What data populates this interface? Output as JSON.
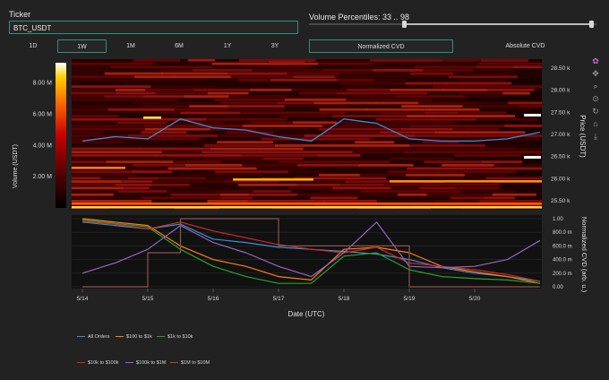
{
  "ticker": {
    "label": "Ticker",
    "value": "BTC_USDT"
  },
  "timeframes": [
    {
      "label": "1D",
      "active": false
    },
    {
      "label": "1W",
      "active": true
    },
    {
      "label": "1M",
      "active": false
    },
    {
      "label": "6M",
      "active": false
    },
    {
      "label": "1Y",
      "active": false
    },
    {
      "label": "3Y",
      "active": false
    }
  ],
  "volume_percentiles": {
    "label": "Volume Percentiles: 33 .. 98",
    "low": 33,
    "high": 98
  },
  "cvd_modes": [
    {
      "label": "Normalized CVD",
      "active": true
    },
    {
      "label": "Absolute CVD",
      "active": false
    }
  ],
  "modebar_icons": [
    "plotly-logo-icon",
    "pan-icon",
    "zoom-icon",
    "lasso-icon",
    "autoscale-icon",
    "reset-icon",
    "save-icon"
  ],
  "chart_data": [
    {
      "type": "heatmap",
      "title": "",
      "ylabel": "Price (USDT)",
      "ylim": [
        25300,
        28700
      ],
      "y_ticks": [
        "25.50 k",
        "26.00 k",
        "26.50 k",
        "27.00 k",
        "27.50 k",
        "28.00 k",
        "28.50 k"
      ],
      "y_tick_values": [
        25500,
        26000,
        26500,
        27000,
        27500,
        28000,
        28500
      ],
      "colorbar": {
        "label": "Volume (USDT)",
        "ticks": [
          "2.00 M",
          "4.00 M",
          "6.00 M",
          "8.00 M"
        ],
        "tick_values": [
          2000000,
          4000000,
          6000000,
          8000000
        ],
        "range": [
          0,
          9300000
        ]
      },
      "colorscale": [
        "#000000",
        "#5a0000",
        "#c40000",
        "#ff6600",
        "#ffd000",
        "#ffffff"
      ],
      "price_series": {
        "name": "",
        "color": "#3b8fd9",
        "x": [
          "2023-05-14",
          "2023-05-14 12:00",
          "2023-05-15",
          "2023-05-15 12:00",
          "2023-05-16",
          "2023-05-16 12:00",
          "2023-05-17",
          "2023-05-17 12:00",
          "2023-05-18",
          "2023-05-18 12:00",
          "2023-05-19",
          "2023-05-19 12:00",
          "2023-05-20",
          "2023-05-20 12:00",
          "2023-05-21"
        ],
        "y": [
          26850,
          26950,
          26900,
          27350,
          27150,
          27100,
          26950,
          26850,
          27350,
          27250,
          26900,
          26850,
          26850,
          26900,
          27050
        ]
      }
    },
    {
      "type": "line",
      "title": "",
      "xlabel": "Date (UTC)",
      "ylabel": "Normalized CVD (arb. u.)",
      "x_ticks": [
        "5/14",
        "5/15",
        "5/16",
        "5/17",
        "5/18",
        "5/19",
        "5/20"
      ],
      "y_left_ticks": [
        "0.00",
        "0.20",
        "0.40",
        "0.60",
        "0.80",
        "1.00"
      ],
      "y_left_values": [
        0,
        0.2,
        0.4,
        0.6,
        0.8,
        1.0
      ],
      "y_right_ticks": [
        "0.00",
        "200.0 m",
        "400.0 m",
        "600.0 m",
        "800.0 m",
        "1.00"
      ],
      "ylim": [
        0,
        1.0
      ],
      "x": [
        "5/14",
        "5/14 12h",
        "5/15",
        "5/15 12h",
        "5/16",
        "5/16 12h",
        "5/17",
        "5/17 12h",
        "5/18",
        "5/18 12h",
        "5/19",
        "5/19 12h",
        "5/20",
        "5/20 12h",
        "5/21"
      ],
      "series": [
        {
          "name": "All Orders",
          "color": "#3a8fd8",
          "values": [
            0.95,
            0.9,
            0.85,
            0.92,
            0.7,
            0.65,
            0.58,
            0.55,
            0.52,
            0.48,
            0.4,
            0.28,
            0.2,
            0.15,
            0.08
          ]
        },
        {
          "name": "$100 to $1k",
          "color": "#ff7f0e",
          "values": [
            1.0,
            0.95,
            0.9,
            0.6,
            0.4,
            0.3,
            0.15,
            0.1,
            0.55,
            0.58,
            0.5,
            0.3,
            0.22,
            0.15,
            0.05
          ]
        },
        {
          "name": "$1k to $10k",
          "color": "#2ca02c",
          "values": [
            0.98,
            0.93,
            0.88,
            0.55,
            0.3,
            0.15,
            0.05,
            0.05,
            0.45,
            0.5,
            0.25,
            0.15,
            0.12,
            0.1,
            0.05
          ]
        },
        {
          "name": "$10k to $100k",
          "color": "#d62728",
          "values": [
            0.96,
            0.92,
            0.85,
            0.95,
            0.82,
            0.72,
            0.62,
            0.55,
            0.5,
            0.58,
            0.35,
            0.3,
            0.25,
            0.18,
            0.08
          ]
        },
        {
          "name": "$100k to $1M",
          "color": "#9467bd",
          "values": [
            0.2,
            0.35,
            0.55,
            0.9,
            0.65,
            0.5,
            0.3,
            0.15,
            0.5,
            0.95,
            0.3,
            0.28,
            0.3,
            0.4,
            0.68
          ]
        },
        {
          "name": "$1M to $10M",
          "color": "#8c564b",
          "values": [
            0.0,
            0.0,
            0.5,
            1.0,
            1.0,
            1.0,
            0.6,
            0.6,
            0.6,
            0.6,
            0.0,
            0.0,
            0.0,
            0.0,
            0.0
          ]
        }
      ]
    }
  ]
}
